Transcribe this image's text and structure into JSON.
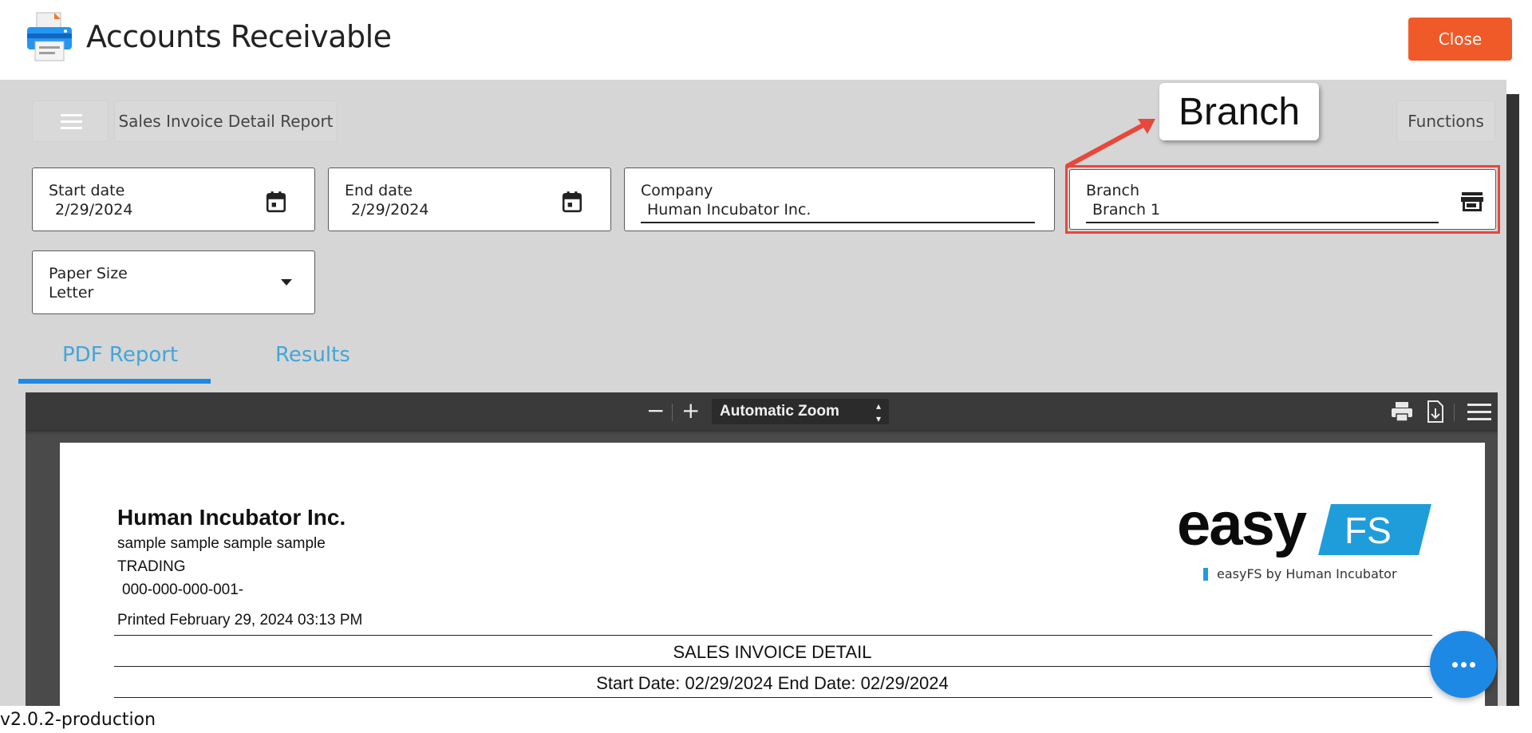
{
  "header": {
    "title": "Accounts Receivable",
    "close_label": "Close",
    "logo_icon": "printer-icon"
  },
  "toolbar": {
    "report_title": "Sales Invoice Detail Report",
    "functions_label": "Functions",
    "menu_icon": "hamburger-menu-icon"
  },
  "filters": {
    "start_date": {
      "label": "Start date",
      "value": "2/29/2024",
      "icon": "calendar-icon"
    },
    "end_date": {
      "label": "End date",
      "value": "2/29/2024",
      "icon": "calendar-icon"
    },
    "company": {
      "label": "Company",
      "value": "Human Incubator Inc."
    },
    "branch": {
      "label": "Branch",
      "value": "Branch 1",
      "icon": "store-icon"
    },
    "paper_size": {
      "label": "Paper Size",
      "value": "Letter",
      "icon": "dropdown-arrow-icon"
    }
  },
  "annotation": {
    "callout_text": "Branch",
    "highlight_color": "#e8473b"
  },
  "tabs": [
    {
      "label": "PDF Report",
      "active": true
    },
    {
      "label": "Results",
      "active": false
    }
  ],
  "pdf_viewer": {
    "zoom_out": "−",
    "zoom_in": "+",
    "zoom_value": "Automatic Zoom",
    "icons": [
      "print-icon",
      "download-icon",
      "tools-menu-icon"
    ]
  },
  "report": {
    "company": "Human Incubator Inc.",
    "address": "sample sample sample sample",
    "type": "TRADING",
    "tin": "000-000-000-001-",
    "printed": "Printed February 29, 2024 03:13 PM",
    "title": "SALES INVOICE DETAIL",
    "date_range": "Start Date: 02/29/2024 End Date: 02/29/2024",
    "brand": {
      "word": "easy",
      "badge": "FS",
      "tagline": "easyFS by Human Incubator",
      "accent": "#1f9ddb"
    }
  },
  "footer": {
    "version": "v2.0.2-production"
  },
  "colors": {
    "close_button": "#f05a28",
    "tab_active": "#1e88e5",
    "tab_text": "#45a5d8",
    "fab": "#1e88e5"
  }
}
